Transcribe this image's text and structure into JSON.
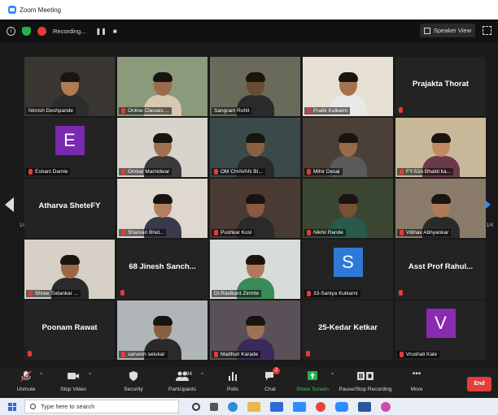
{
  "window": {
    "title": "Zoom Meeting"
  },
  "topbar": {
    "recording_label": "Recording...",
    "speaker_view_label": "Speaker View"
  },
  "pages": {
    "left": "1/4",
    "right": "1/4"
  },
  "tiles": [
    {
      "name": "Nimish Deshpande",
      "kind": "video",
      "bg": "#3a3632",
      "skin": "#b07a55",
      "shirt": "#2d2d2d"
    },
    {
      "name": "Online Classes ...",
      "kind": "video",
      "bg": "#8a9a7a",
      "skin": "#9a6a4a",
      "shirt": "#d8c8b0",
      "muted": true
    },
    {
      "name": "Sangram Rohit",
      "kind": "video",
      "bg": "#6a6a5a",
      "skin": "#6a4a32",
      "shirt": "#2a2a2a",
      "active": true
    },
    {
      "name": "Pratik Kulkarni",
      "kind": "video",
      "bg": "#e6e0d4",
      "skin": "#a57250",
      "shirt": "#e8e8e8",
      "muted": true
    },
    {
      "name": "Prajakta Thorat",
      "kind": "text",
      "muted": true
    },
    {
      "name": "Eshani Damle",
      "kind": "letter",
      "letter": "E",
      "color": "#7a2ab0",
      "muted": true
    },
    {
      "name": "Omkar Mamidwar",
      "kind": "video",
      "bg": "#d8d4cc",
      "skin": "#a07050",
      "shirt": "#3a3a3a",
      "muted": true
    },
    {
      "name": "OM CHAVAN BI...",
      "kind": "video",
      "bg": "#3a4a48",
      "skin": "#8a6040",
      "shirt": "#2a2a2a",
      "muted": true
    },
    {
      "name": "Mihir Desai",
      "kind": "video",
      "bg": "#4a4038",
      "skin": "#9a6a48",
      "shirt": "#5a5a5a",
      "muted": true
    },
    {
      "name": "FY-53A Bhakti ka...",
      "kind": "video",
      "bg": "#c8b89a",
      "skin": "#c08a62",
      "shirt": "#6a3a4a",
      "muted": true
    },
    {
      "name": "Atharva SheteFY",
      "kind": "text"
    },
    {
      "name": "Sharvari Bhid...",
      "kind": "video",
      "bg": "#ded8d0",
      "skin": "#b08060",
      "shirt": "#3a3a4a",
      "muted": true
    },
    {
      "name": "Pushkar Kosl",
      "kind": "video",
      "bg": "#4a3a34",
      "skin": "#8a5a40",
      "shirt": "#2a2a2a",
      "muted": true
    },
    {
      "name": "Nikhil Rande",
      "kind": "video",
      "bg": "#3a4632",
      "skin": "#7a5032",
      "shirt": "#2a5a4a",
      "muted": true
    },
    {
      "name": "Vibhav Abhyankar",
      "kind": "video",
      "bg": "#8a7a6a",
      "skin": "#b07a58",
      "shirt": "#2a2a2a",
      "muted": true
    },
    {
      "name": "Shree Todankar ...",
      "kind": "video",
      "bg": "#d6d0c6",
      "skin": "#9a6a48",
      "shirt": "#2a2a2a",
      "muted": true
    },
    {
      "name": "68 Jinesh Sanch...",
      "kind": "text",
      "muted": true
    },
    {
      "name": "Dr.Ravikant Zirmite",
      "kind": "video",
      "bg": "#d8dcd8",
      "skin": "#b07a58",
      "shirt": "#3a8a5a"
    },
    {
      "name": "33-Saniya Kulkarni",
      "kind": "letter",
      "letter": "S",
      "color": "#2d7ad6",
      "muted": true
    },
    {
      "name": "Asst Prof Rahul...",
      "kind": "text",
      "muted": true
    },
    {
      "name": "Poonam Rawat",
      "kind": "text",
      "muted": true
    },
    {
      "name": "sarvesh selukar",
      "kind": "video",
      "bg": "#b0b6b8",
      "skin": "#8a6040",
      "shirt": "#2a2a2a",
      "muted": true
    },
    {
      "name": "Madhuri Karade",
      "kind": "video",
      "bg": "#5a5058",
      "skin": "#a07058",
      "shirt": "#3a2a5a",
      "muted": true
    },
    {
      "name": "25-Kedar Ketkar",
      "kind": "text",
      "muted": true
    },
    {
      "name": "Vrushali Kale",
      "kind": "letter",
      "letter": "V",
      "color": "#8a2ab0",
      "muted": true
    }
  ],
  "toolbar": {
    "unmute": "Unmute",
    "stop_video": "Stop Video",
    "security": "Security",
    "participants": "Participants",
    "participants_count": "94",
    "polls": "Polls",
    "chat": "Chat",
    "chat_badge": "2",
    "share_screen": "Share Screen",
    "pause_recording": "Pause/Stop Recording",
    "more": "More",
    "end": "End"
  },
  "taskbar": {
    "search_placeholder": "Type here to search"
  },
  "colors": {
    "accent": "#2d8cff",
    "share": "#27b04a",
    "end": "#e23c3c",
    "active_border": "#c9d44a"
  }
}
